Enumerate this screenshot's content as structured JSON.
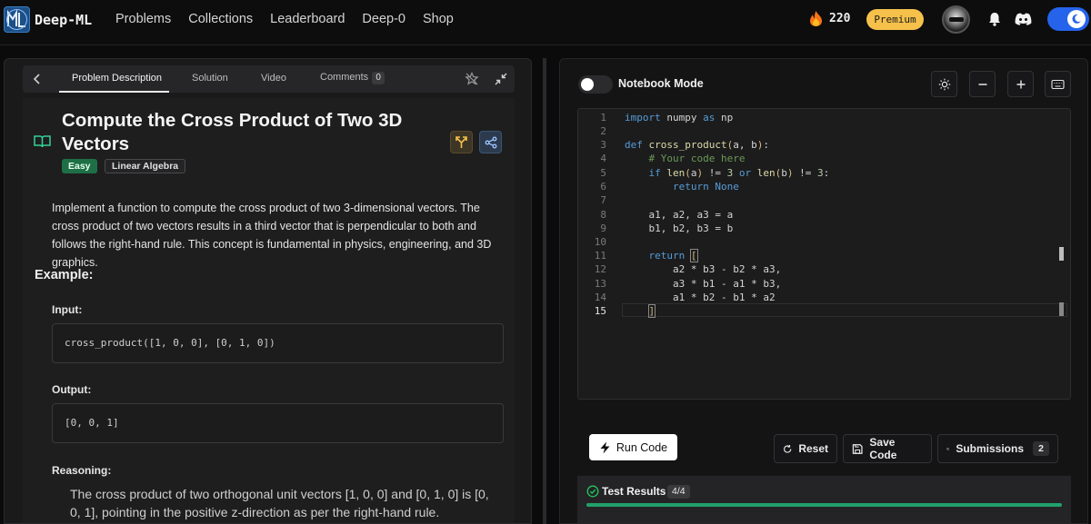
{
  "nav": {
    "brand": "Deep-ML",
    "links": [
      "Problems",
      "Collections",
      "Leaderboard",
      "Deep-0",
      "Shop"
    ],
    "streak": "220",
    "premium": "Premium"
  },
  "tabs": {
    "items": [
      "Problem Description",
      "Solution",
      "Video",
      "Comments"
    ],
    "comments_count": "0"
  },
  "problem": {
    "title": "Compute the Cross Product of Two 3D Vectors",
    "difficulty": "Easy",
    "topic": "Linear Algebra",
    "description": "Implement a function to compute the cross product of two 3-dimensional vectors. The cross product of two vectors results in a third vector that is perpendicular to both and follows the right-hand rule. This concept is fundamental in physics, engineering, and 3D graphics.",
    "example_heading": "Example:",
    "input_label": "Input:",
    "input": "cross_product([1, 0, 0], [0, 1, 0])",
    "output_label": "Output:",
    "output": "[0, 0, 1]",
    "reasoning_label": "Reasoning:",
    "reasoning": "The cross product of two orthogonal unit vectors [1, 0, 0] and [0, 1, 0] is [0, 0, 1], pointing in the positive z-direction as per the right-hand rule."
  },
  "editor": {
    "notebook_label": "Notebook Mode",
    "current_line": 15
  },
  "actions": {
    "run": "Run Code",
    "reset": "Reset",
    "save": "Save Code",
    "submissions": "Submissions",
    "submissions_count": "2"
  },
  "results": {
    "title": "Test Results",
    "count": "4/4",
    "passed_fraction": 1.0
  },
  "colors": {
    "accent_blue": "#2563eb",
    "premium_yellow": "#f5c14b",
    "easy_green": "#1f6f46",
    "progress_green": "#22a06b"
  }
}
